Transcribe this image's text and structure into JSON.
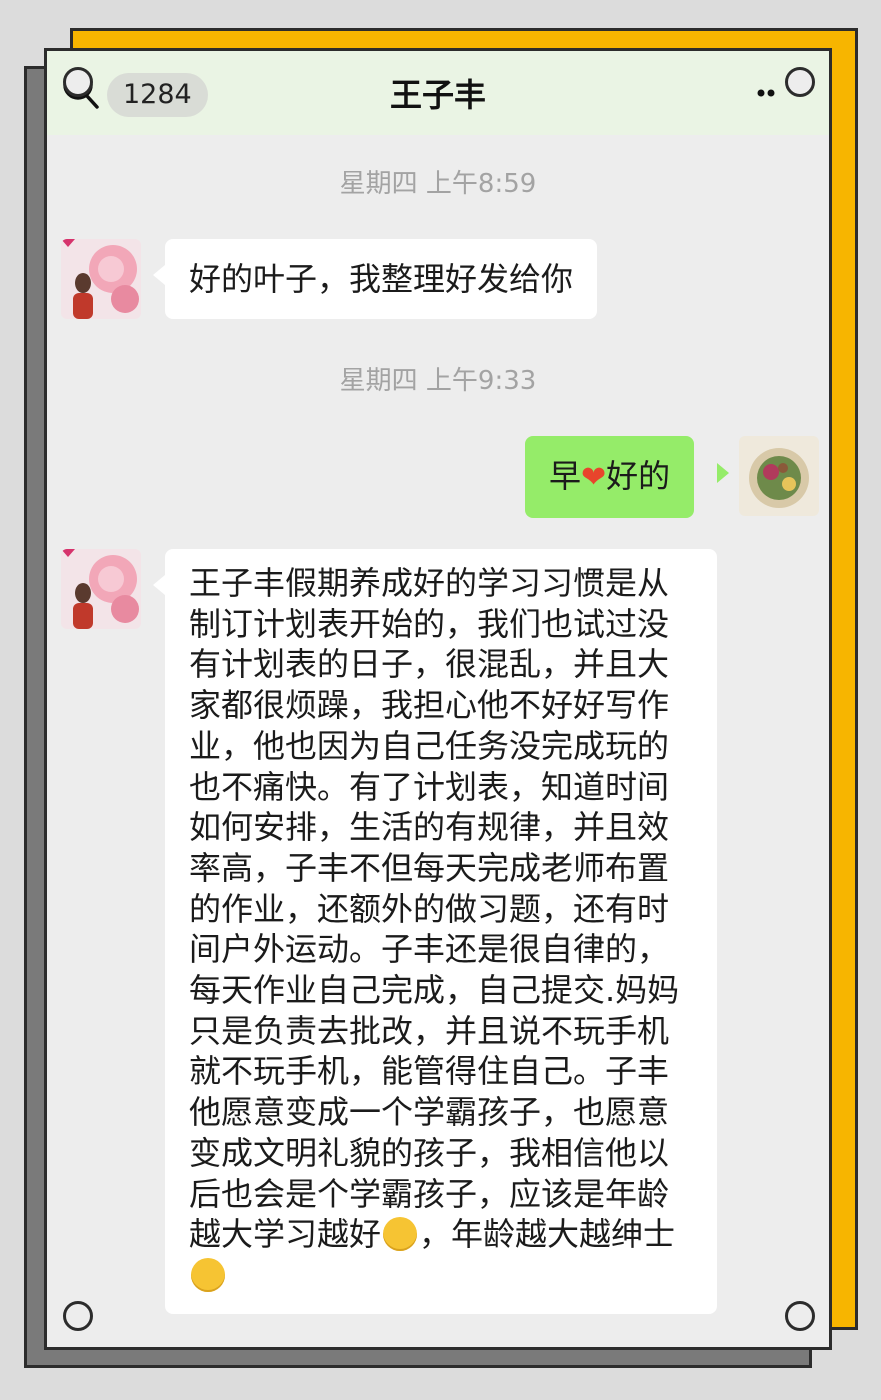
{
  "header": {
    "unread_count": "1284",
    "chat_title": "王子丰"
  },
  "messages": [
    {
      "type": "timestamp",
      "text": "星期四 上午8:59"
    },
    {
      "type": "received",
      "text": "好的叶子，我整理好发给你"
    },
    {
      "type": "timestamp",
      "text": "星期四 上午9:33"
    },
    {
      "type": "sent",
      "text_before": "早",
      "emoji": "heart",
      "text_after": "好的"
    },
    {
      "type": "received",
      "segment1": "王子丰假期养成好的学习习惯是从制订计划表开始的，我们也试过没有计划表的日子，很混乱，并且大家都很烦躁，我担心他不好好写作业，他也因为自己任务没完成玩的也不痛快。有了计划表，知道时间如何安排，生活的有规律，并且效率高，子丰不但每天完成老师布置的作业，还额外的做习题，还有时间户外运动。子丰还是很自律的，每天作业自己完成，自己提交.妈妈只是负责去批改，并且说不玩手机就不玩手机，能管得住自己。子丰他愿意变成一个学霸孩子，也愿意变成文明礼貌的孩子，我相信他以后也会是个学霸孩子，应该是年龄越大学习越好",
      "emoji1": "grin",
      "segment2": "，年龄越大越绅士",
      "emoji2": "grin"
    }
  ],
  "colors": {
    "sent_bubble": "#95ec69",
    "received_bubble": "#ffffff",
    "nav_background": "#eaf4e4",
    "chat_background": "#ededed",
    "frame_accent": "#f7b500"
  }
}
